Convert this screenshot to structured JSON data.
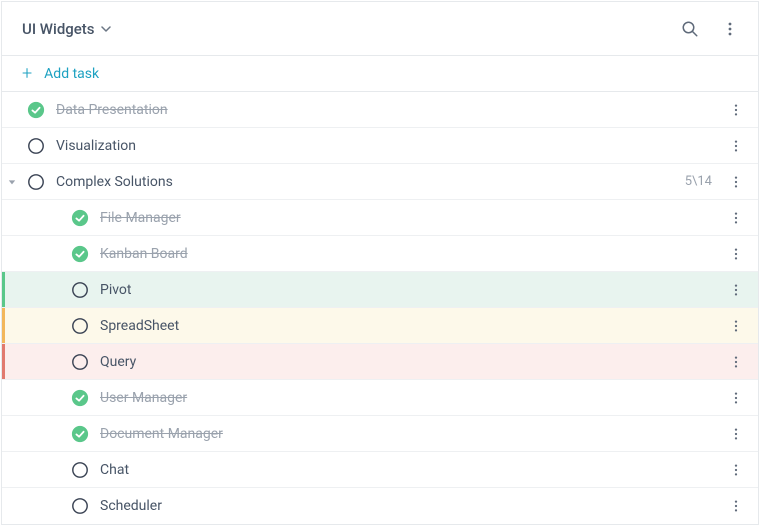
{
  "header": {
    "title": "UI Widgets"
  },
  "add_task_label": "Add task",
  "counter": "5\\14",
  "tasks": {
    "data_presentation": "Data Presentation",
    "visualization": "Visualization",
    "complex_solutions": "Complex Solutions",
    "file_manager": "File Manager",
    "kanban_board": "Kanban Board",
    "pivot": "Pivot",
    "spreadsheet": "SpreadSheet",
    "query": "Query",
    "user_manager": "User Manager",
    "document_manager": "Document Manager",
    "chat": "Chat",
    "scheduler": "Scheduler"
  },
  "colors": {
    "accent_green": "#5ac78a",
    "accent_yellow": "#f2b75c",
    "accent_red": "#e17a6f",
    "check_complete": "#5ac78a",
    "link": "#1ca1c1"
  }
}
